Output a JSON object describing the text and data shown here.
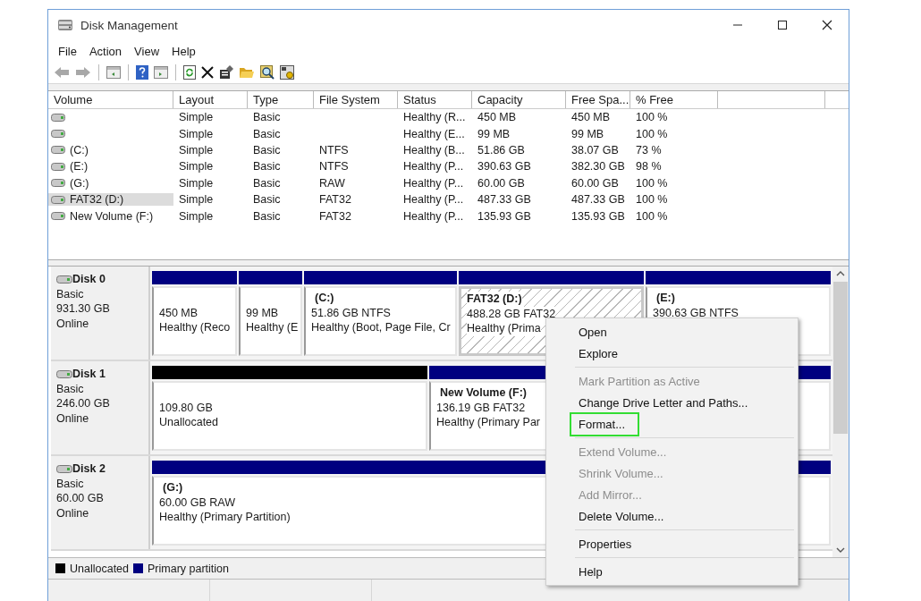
{
  "window": {
    "title": "Disk Management"
  },
  "menu": [
    "File",
    "Action",
    "View",
    "Help"
  ],
  "volumes": {
    "columns": [
      "Volume",
      "Layout",
      "Type",
      "File System",
      "Status",
      "Capacity",
      "Free Spa...",
      "% Free"
    ],
    "rows": [
      {
        "selected": false,
        "cells": [
          "",
          "Simple",
          "Basic",
          "",
          "Healthy (R...",
          "450 MB",
          "450 MB",
          "100 %"
        ]
      },
      {
        "selected": false,
        "cells": [
          "",
          "Simple",
          "Basic",
          "",
          "Healthy (E...",
          "99 MB",
          "99 MB",
          "100 %"
        ]
      },
      {
        "selected": false,
        "cells": [
          "(C:)",
          "Simple",
          "Basic",
          "NTFS",
          "Healthy (B...",
          "51.86 GB",
          "38.07 GB",
          "73 %"
        ]
      },
      {
        "selected": false,
        "cells": [
          "(E:)",
          "Simple",
          "Basic",
          "NTFS",
          "Healthy (P...",
          "390.63 GB",
          "382.30 GB",
          "98 %"
        ]
      },
      {
        "selected": false,
        "cells": [
          "(G:)",
          "Simple",
          "Basic",
          "RAW",
          "Healthy (P...",
          "60.00 GB",
          "60.00 GB",
          "100 %"
        ]
      },
      {
        "selected": true,
        "cells": [
          "FAT32 (D:)",
          "Simple",
          "Basic",
          "FAT32",
          "Healthy (P...",
          "487.33 GB",
          "487.33 GB",
          "100 %"
        ]
      },
      {
        "selected": false,
        "cells": [
          "New Volume (F:)",
          "Simple",
          "Basic",
          "FAT32",
          "Healthy (P...",
          "135.93 GB",
          "135.93 GB",
          "100 %"
        ]
      }
    ]
  },
  "disks": [
    {
      "name": "Disk 0",
      "type": "Basic",
      "size": "931.30 GB",
      "status": "Online",
      "partitions": [
        {
          "kind": "primary",
          "selected": false,
          "lines": [
            "450 MB",
            "Healthy (Reco"
          ]
        },
        {
          "kind": "primary",
          "selected": false,
          "lines": [
            "99 MB",
            "Healthy (E"
          ]
        },
        {
          "kind": "primary",
          "selected": false,
          "title": "(C:)",
          "lines": [
            "51.86 GB NTFS",
            "Healthy (Boot, Page File, Cr"
          ]
        },
        {
          "kind": "primary",
          "selected": true,
          "title": "FAT32  (D:)",
          "lines": [
            "488.28 GB FAT32",
            "Healthy (Prima"
          ]
        },
        {
          "kind": "primary",
          "selected": false,
          "title": "(E:)",
          "lines": [
            "390.63 GB NTFS"
          ]
        }
      ]
    },
    {
      "name": "Disk 1",
      "type": "Basic",
      "size": "246.00 GB",
      "status": "Online",
      "partitions": [
        {
          "kind": "unallocated",
          "selected": false,
          "lines": [
            "109.80 GB",
            "Unallocated"
          ]
        },
        {
          "kind": "primary",
          "selected": false,
          "title": "New Volume  (F:)",
          "lines": [
            "136.19 GB FAT32",
            "Healthy (Primary Par"
          ]
        }
      ]
    },
    {
      "name": "Disk 2",
      "type": "Basic",
      "size": "60.00 GB",
      "status": "Online",
      "partitions": [
        {
          "kind": "primary",
          "selected": false,
          "title": "(G:)",
          "lines": [
            "60.00 GB RAW",
            "Healthy (Primary Partition)"
          ]
        }
      ]
    }
  ],
  "legend": [
    {
      "label": "Unallocated",
      "color": "#000000"
    },
    {
      "label": "Primary partition",
      "color": "#000080"
    }
  ],
  "context_menu": {
    "sections": [
      [
        {
          "label": "Open",
          "disabled": false,
          "highlighted": false
        },
        {
          "label": "Explore",
          "disabled": false,
          "highlighted": false
        }
      ],
      [
        {
          "label": "Mark Partition as Active",
          "disabled": true,
          "highlighted": false
        },
        {
          "label": "Change Drive Letter and Paths...",
          "disabled": false,
          "highlighted": false
        },
        {
          "label": "Format...",
          "disabled": false,
          "highlighted": true
        }
      ],
      [
        {
          "label": "Extend Volume...",
          "disabled": true,
          "highlighted": false
        },
        {
          "label": "Shrink Volume...",
          "disabled": true,
          "highlighted": false
        },
        {
          "label": "Add Mirror...",
          "disabled": true,
          "highlighted": false
        },
        {
          "label": "Delete Volume...",
          "disabled": false,
          "highlighted": false
        }
      ],
      [
        {
          "label": "Properties",
          "disabled": false,
          "highlighted": false
        }
      ],
      [
        {
          "label": "Help",
          "disabled": false,
          "highlighted": false
        }
      ]
    ]
  }
}
